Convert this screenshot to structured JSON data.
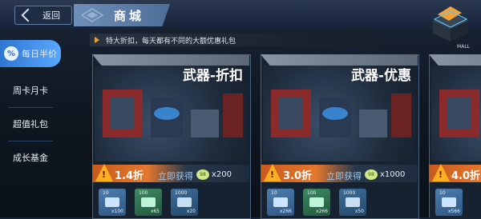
{
  "header": {
    "back_label": "返回",
    "title": "商城",
    "mall_label": "MALL"
  },
  "marquee": "特大折扣，每天都有不同的大额优惠礼包",
  "sidebar": {
    "items": [
      {
        "label": "每日半价",
        "badge": "%"
      },
      {
        "label": "周卡月卡"
      },
      {
        "label": "超值礼包"
      },
      {
        "label": "成长基金"
      }
    ]
  },
  "cards": [
    {
      "title": "武器-折扣",
      "discount": "1.4折",
      "get_label": "立即获得",
      "coin_icon": "coin-icon",
      "coin_text": "98",
      "count": "x200",
      "items": [
        {
          "top": "10",
          "bottom": "x100",
          "color": "blue"
        },
        {
          "top": "100",
          "bottom": "x65",
          "color": "green"
        },
        {
          "top": "1000",
          "bottom": "x20",
          "color": "teal"
        }
      ]
    },
    {
      "title": "武器-优惠",
      "discount": "3.0折",
      "get_label": "立即获得",
      "coin_icon": "coin-icon",
      "coin_text": "98",
      "count": "x1000",
      "items": [
        {
          "top": "10",
          "bottom": "x266",
          "color": "blue"
        },
        {
          "top": "100",
          "bottom": "x266",
          "color": "green"
        },
        {
          "top": "1000",
          "bottom": "x50",
          "color": "teal"
        }
      ]
    },
    {
      "title": "",
      "discount": "4.0折",
      "get_label": "",
      "coin_icon": "coin-icon",
      "coin_text": "",
      "count": "",
      "items": [
        {
          "top": "10",
          "bottom": "x566",
          "color": "blue"
        },
        {
          "top": "",
          "bottom": "",
          "color": "green"
        }
      ]
    }
  ],
  "colors": {
    "accent_blue": "#3a8bf0",
    "discount_orange": "#e4782e",
    "warning_yellow": "#ffae22"
  }
}
